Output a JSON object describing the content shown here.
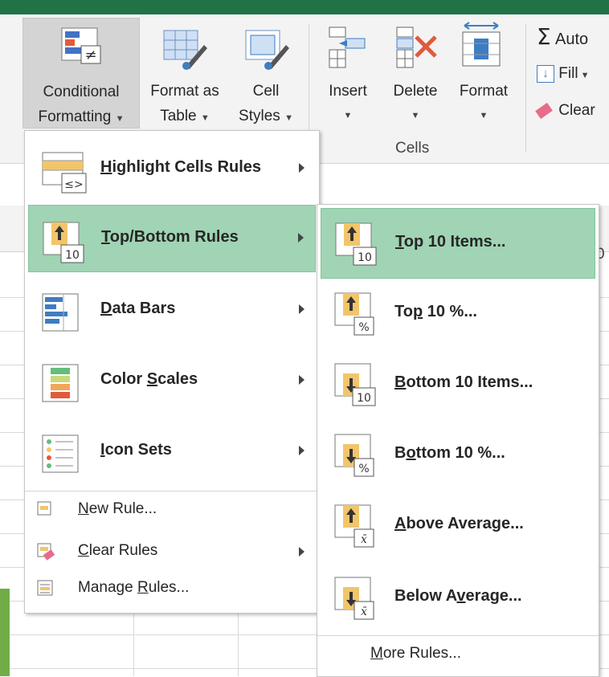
{
  "ribbon": {
    "conditional_formatting": {
      "line1": "Conditional",
      "line2": "Formatting",
      "icon": "conditional-formatting-icon"
    },
    "format_as_table": {
      "line1": "Format as",
      "line2": "Table",
      "icon": "format-as-table-icon"
    },
    "cell_styles": {
      "line1": "Cell",
      "line2": "Styles",
      "icon": "cell-styles-icon"
    },
    "insert": {
      "line1": "Insert",
      "icon": "insert-cells-icon"
    },
    "delete": {
      "line1": "Delete",
      "icon": "delete-cells-icon"
    },
    "format": {
      "line1": "Format",
      "icon": "format-cells-icon"
    },
    "cells_group_label": "Cells",
    "autosum": {
      "label": "Auto",
      "icon": "autosum-icon"
    },
    "fill": {
      "label": "Fill",
      "icon": "fill-down-icon"
    },
    "clear": {
      "label": "Clear",
      "icon": "eraser-icon"
    }
  },
  "conditional_menu": {
    "highlight_cells_rules": {
      "before": "",
      "accel": "H",
      "after": "ighlight Cells Rules",
      "icon": "highlight-cells-icon"
    },
    "top_bottom_rules": {
      "before": "",
      "accel": "T",
      "after": "op/Bottom Rules",
      "icon": "top-bottom-icon"
    },
    "data_bars": {
      "before": "",
      "accel": "D",
      "after": "ata Bars",
      "icon": "data-bars-icon"
    },
    "color_scales": {
      "before": "Color ",
      "accel": "S",
      "after": "cales",
      "icon": "color-scales-icon"
    },
    "icon_sets": {
      "before": "",
      "accel": "I",
      "after": "con Sets",
      "icon": "icon-sets-icon"
    },
    "new_rule": {
      "before": "",
      "accel": "N",
      "after": "ew Rule...",
      "icon": "new-rule-icon"
    },
    "clear_rules": {
      "before": "",
      "accel": "C",
      "after": "lear Rules",
      "icon": "clear-rules-icon"
    },
    "manage_rules": {
      "before": "Manage ",
      "accel": "R",
      "after": "ules...",
      "icon": "manage-rules-icon"
    }
  },
  "top_bottom_submenu": {
    "top10_items": {
      "before": "",
      "accel": "T",
      "after": "op 10 Items...",
      "badge": "10"
    },
    "top10_percent": {
      "before": "To",
      "accel": "p",
      "after": " 10 %...",
      "badge": "%"
    },
    "bottom10_items": {
      "before": "",
      "accel": "B",
      "after": "ottom 10 Items...",
      "badge": "10"
    },
    "bottom10_percent": {
      "before": "B",
      "accel": "o",
      "after": "ttom 10 %...",
      "badge": "%"
    },
    "above_average": {
      "before": "",
      "accel": "A",
      "after": "bove Average...",
      "badge": "x̄"
    },
    "below_average": {
      "before": "Below A",
      "accel": "v",
      "after": "erage...",
      "badge": "x̄"
    },
    "more_rules": {
      "before": "",
      "accel": "M",
      "after": "ore Rules..."
    }
  },
  "colors": {
    "highlight": "#a0d4b4",
    "excel_green": "#217346",
    "accent_orange": "#f2c56b"
  }
}
